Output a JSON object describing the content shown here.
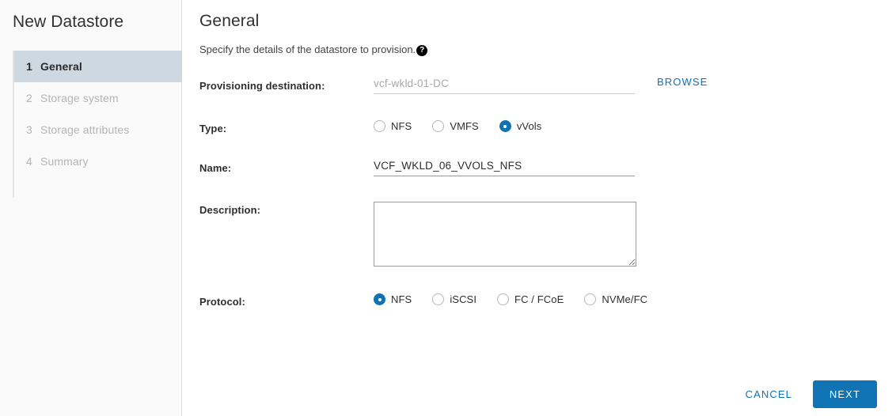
{
  "sidebar": {
    "title": "New Datastore",
    "steps": [
      {
        "num": "1",
        "label": "General",
        "active": true
      },
      {
        "num": "2",
        "label": "Storage system",
        "active": false
      },
      {
        "num": "3",
        "label": "Storage attributes",
        "active": false
      },
      {
        "num": "4",
        "label": "Summary",
        "active": false
      }
    ]
  },
  "main": {
    "page_title": "General",
    "subtitle": "Specify the details of the datastore to provision.",
    "help_icon_glyph": "?",
    "help_icon_name": "help-circle-icon"
  },
  "form": {
    "provisioning_destination": {
      "label": "Provisioning destination:",
      "value": "",
      "placeholder": "vcf-wkld-01-DC",
      "browse_label": "BROWSE"
    },
    "type": {
      "label": "Type:",
      "options": [
        {
          "label": "NFS",
          "checked": false
        },
        {
          "label": "VMFS",
          "checked": false
        },
        {
          "label": "vVols",
          "checked": true
        }
      ]
    },
    "name": {
      "label": "Name:",
      "value": "VCF_WKLD_06_VVOLS_NFS",
      "placeholder": ""
    },
    "description": {
      "label": "Description:",
      "value": "",
      "placeholder": ""
    },
    "protocol": {
      "label": "Protocol:",
      "options": [
        {
          "label": "NFS",
          "checked": true
        },
        {
          "label": "iSCSI",
          "checked": false
        },
        {
          "label": "FC / FCoE",
          "checked": false
        },
        {
          "label": "NVMe/FC",
          "checked": false
        }
      ]
    }
  },
  "footer": {
    "cancel_label": "CANCEL",
    "next_label": "NEXT"
  },
  "colors": {
    "accent_blue": "#0f73b4",
    "sidebar_bg": "#fafafa",
    "active_step_bg": "#cdd8e0",
    "divider": "#d9dde1"
  }
}
